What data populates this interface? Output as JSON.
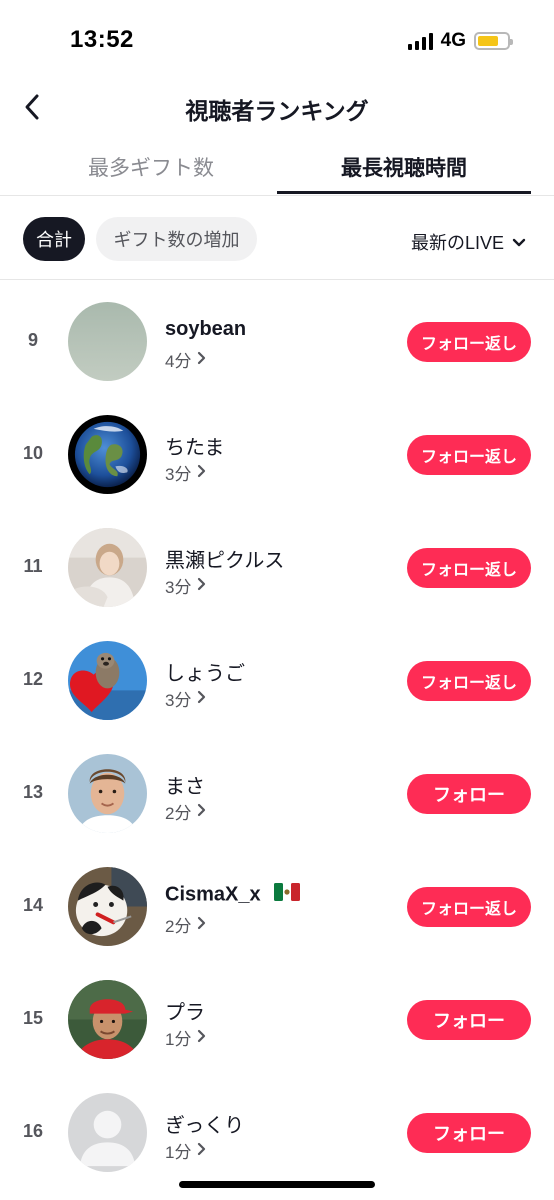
{
  "status_bar": {
    "time": "13:52",
    "network": "4G",
    "battery_level": 0.7,
    "battery_color": "#f5c518"
  },
  "header": {
    "back_icon": "chevron-left-icon",
    "title": "視聴者ランキング"
  },
  "tabs": [
    {
      "label": "最多ギフト数",
      "selected": false
    },
    {
      "label": "最長視聴時間",
      "selected": true
    }
  ],
  "filters": {
    "chips": [
      {
        "label": "合計",
        "selected": true
      },
      {
        "label": "ギフト数の増加",
        "selected": false
      }
    ],
    "sort_label": "最新のLIVE",
    "sort_icon": "chevron-down-icon"
  },
  "viewers": [
    {
      "rank": "9",
      "name": "soybean",
      "watch_time": "4分",
      "button": "フォロー返し",
      "avatar": "gray-green"
    },
    {
      "rank": "10",
      "name": "ちたま",
      "watch_time": "3分",
      "button": "フォロー返し",
      "avatar": "earth"
    },
    {
      "rank": "11",
      "name": "黒瀬ピクルス",
      "watch_time": "3分",
      "button": "フォロー返し",
      "avatar": "person-photo"
    },
    {
      "rank": "12",
      "name": "しょうご",
      "watch_time": "3分",
      "button": "フォロー返し",
      "avatar": "otter"
    },
    {
      "rank": "13",
      "name": "まさ",
      "watch_time": "2分",
      "button": "フォロー",
      "avatar": "face-photo"
    },
    {
      "rank": "14",
      "name": "CismaX_x",
      "watch_time": "2分",
      "button": "フォロー返し",
      "avatar": "cat",
      "flag": "mexico-flag"
    },
    {
      "rank": "15",
      "name": "プラ",
      "watch_time": "1分",
      "button": "フォロー",
      "avatar": "man-red-cap"
    },
    {
      "rank": "16",
      "name": "ぎっくり",
      "watch_time": "1分",
      "button": "フォロー",
      "avatar": "default-user"
    }
  ],
  "colors": {
    "accent": "#fe2c55",
    "text_primary": "#161823",
    "text_secondary": "#55565c",
    "chip_selected_bg": "#161823"
  }
}
